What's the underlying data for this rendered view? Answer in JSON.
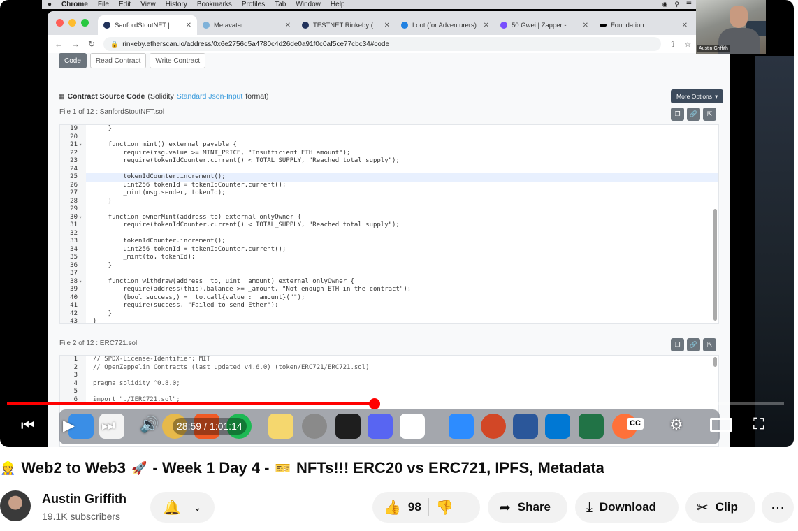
{
  "mac_menubar": {
    "apple_icon": "apple-logo",
    "app": "Chrome",
    "items": [
      "File",
      "Edit",
      "View",
      "History",
      "Bookmarks",
      "Profiles",
      "Tab",
      "Window",
      "Help"
    ]
  },
  "browser": {
    "tabs": [
      {
        "label": "SanfordStoutNFT | Address",
        "active": true,
        "favicon": "etherscan"
      },
      {
        "label": "Metavatar",
        "active": false,
        "favicon": "metavatar"
      },
      {
        "label": "TESTNET Rinkeby (ETH)",
        "active": false,
        "favicon": "etherscan"
      },
      {
        "label": "Loot (for Adventurers)",
        "active": false,
        "favicon": "opensea"
      },
      {
        "label": "50 Gwei | Zapper - Your",
        "active": false,
        "favicon": "zapper"
      },
      {
        "label": "Foundation",
        "active": false,
        "favicon": "foundation"
      }
    ],
    "url": "rinkeby.etherscan.io/address/0x6e2756d5a4780c4d26de0a91f0c0af5ce77cbc34#code"
  },
  "etherscan": {
    "code_tabs": [
      {
        "label": "Code",
        "active": true
      },
      {
        "label": "Read Contract",
        "active": false
      },
      {
        "label": "Write Contract",
        "active": false
      }
    ],
    "source_title": "Contract Source Code",
    "source_sub_prefix": "(Solidity",
    "source_sub_link": "Standard Json-Input",
    "source_sub_suffix": "format)",
    "more_options": "More Options",
    "file1_label": "File 1 of 12 : SanfordStoutNFT.sol",
    "file1_lines": [
      {
        "n": "19",
        "fold": false,
        "text": "    }"
      },
      {
        "n": "20",
        "fold": false,
        "text": ""
      },
      {
        "n": "21",
        "fold": true,
        "text": "    function mint() external payable {"
      },
      {
        "n": "22",
        "fold": false,
        "text": "        require(msg.value >= MINT_PRICE, \"Insufficient ETH amount\");"
      },
      {
        "n": "23",
        "fold": false,
        "text": "        require(tokenIdCounter.current() < TOTAL_SUPPLY, \"Reached total supply\");"
      },
      {
        "n": "24",
        "fold": false,
        "text": ""
      },
      {
        "n": "25",
        "fold": false,
        "text": "        tokenIdCounter.increment();",
        "highlight": true
      },
      {
        "n": "26",
        "fold": false,
        "text": "        uint256 tokenId = tokenIdCounter.current();"
      },
      {
        "n": "27",
        "fold": false,
        "text": "        _mint(msg.sender, tokenId);"
      },
      {
        "n": "28",
        "fold": false,
        "text": "    }"
      },
      {
        "n": "29",
        "fold": false,
        "text": ""
      },
      {
        "n": "30",
        "fold": true,
        "text": "    function ownerMint(address to) external onlyOwner {"
      },
      {
        "n": "31",
        "fold": false,
        "text": "        require(tokenIdCounter.current() < TOTAL_SUPPLY, \"Reached total supply\");"
      },
      {
        "n": "32",
        "fold": false,
        "text": ""
      },
      {
        "n": "33",
        "fold": false,
        "text": "        tokenIdCounter.increment();"
      },
      {
        "n": "34",
        "fold": false,
        "text": "        uint256 tokenId = tokenIdCounter.current();"
      },
      {
        "n": "35",
        "fold": false,
        "text": "        _mint(to, tokenId);"
      },
      {
        "n": "36",
        "fold": false,
        "text": "    }"
      },
      {
        "n": "37",
        "fold": false,
        "text": ""
      },
      {
        "n": "38",
        "fold": true,
        "text": "    function withdraw(address _to, uint _amount) external onlyOwner {"
      },
      {
        "n": "39",
        "fold": false,
        "text": "        require(address(this).balance >= _amount, \"Not enough ETH in the contract\");"
      },
      {
        "n": "40",
        "fold": false,
        "text": "        (bool success,) = _to.call{value : _amount}(\"\");"
      },
      {
        "n": "41",
        "fold": false,
        "text": "        require(success, \"Failed to send Ether\");"
      },
      {
        "n": "42",
        "fold": false,
        "text": "    }"
      },
      {
        "n": "43",
        "fold": false,
        "text": "}"
      }
    ],
    "file2_label": "File 2 of 12 : ERC721.sol",
    "file2_lines": [
      {
        "n": "1",
        "text": "// SPDX-License-Identifier: MIT"
      },
      {
        "n": "2",
        "text": "// OpenZeppelin Contracts (last updated v4.6.0) (token/ERC721/ERC721.sol)"
      },
      {
        "n": "3",
        "text": ""
      },
      {
        "n": "4",
        "text": "pragma solidity ^0.8.0;"
      },
      {
        "n": "5",
        "text": ""
      },
      {
        "n": "6",
        "text": "import \"./IERC721.sol\";"
      }
    ]
  },
  "webcam": {
    "name": "Austin Griffith"
  },
  "player": {
    "current_time": "28:59",
    "duration": "1:01:14",
    "progress_fraction": 0.4734,
    "accent": "#ff0000",
    "controls": [
      "previous-icon",
      "play-icon",
      "next-icon",
      "volume-icon",
      "captions-icon",
      "settings-icon",
      "miniplayer-icon",
      "theater-icon",
      "fullscreen-icon"
    ]
  },
  "video": {
    "title": "Web2 to Web3 🚀 - Week 1 Day 4 - 🎫 NFTs!!! ERC20 vs ERC721, IPFS, Metadata",
    "title_lead_emoji": "👷",
    "title_main": "Web2 to Web3",
    "title_rocket": "🚀",
    "title_mid": "- Week 1 Day 4 -",
    "title_ticket": "🎫",
    "title_tail": "NFTs!!! ERC20 vs ERC721, IPFS, Metadata",
    "channel": "Austin Griffith",
    "subscribers": "19.1K subscribers",
    "likes": "98",
    "share_label": "Share",
    "download_label": "Download",
    "clip_label": "Clip"
  }
}
